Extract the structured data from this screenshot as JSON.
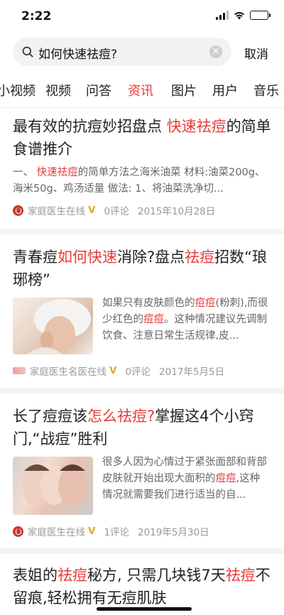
{
  "status": {
    "time": "2:22"
  },
  "search": {
    "query": "如何快速祛痘?",
    "cancel_label": "取消"
  },
  "tabs": [
    "小视频",
    "视频",
    "问答",
    "资讯",
    "图片",
    "用户",
    "音乐"
  ],
  "active_tab": "资讯",
  "colors": {
    "accent": "#e83a3a",
    "meta": "#999999",
    "verified": "#e6a825"
  },
  "results": [
    {
      "title_parts": [
        "最有效的抗痘妙招盘点 ",
        "快速祛痘",
        "的简单食谱推介"
      ],
      "abstract_parts": [
        "一、 ",
        "快速祛痘",
        "的简单方法之海米油菜 材料:油菜200g、海米50g、鸡汤适量 做法: 1、将油菜洗净切..."
      ],
      "source": "家庭医生在线",
      "verified": "V",
      "comments": "0评论",
      "date": "2015年10月28日"
    },
    {
      "title_parts": [
        "青春痘",
        "如何快速",
        "消除?盘点",
        "祛痘",
        "招数“琅琊榜”"
      ],
      "abstract_parts": [
        "如果只有皮肤颜色的",
        "痘痘",
        "(粉刺),而很少红色的",
        "痘痘",
        "。这种情况建议先调制饮食、注意日常生活规律,皮..."
      ],
      "source": "家庭医生名医在线",
      "verified": "V",
      "comments": "0评论",
      "date": "2017年5月5日"
    },
    {
      "title_parts": [
        "长了痘痘该",
        "怎么祛痘?",
        "掌握这4个小窍门,“战痘”胜利"
      ],
      "abstract_parts": [
        "很多人因为心情过于紧张面部和背部皮肤就开始出现大面积的",
        "痘痘",
        ",这种情况就需要我们进行适当的自..."
      ],
      "source": "家庭医生在线",
      "verified": "V",
      "comments": "1评论",
      "date": "2019年5月30日"
    },
    {
      "title_parts": [
        "表姐的",
        "祛痘",
        "秘方, 只需几块钱7天",
        "祛痘",
        "不留痕,轻松拥有无痘肌肤"
      ]
    }
  ]
}
